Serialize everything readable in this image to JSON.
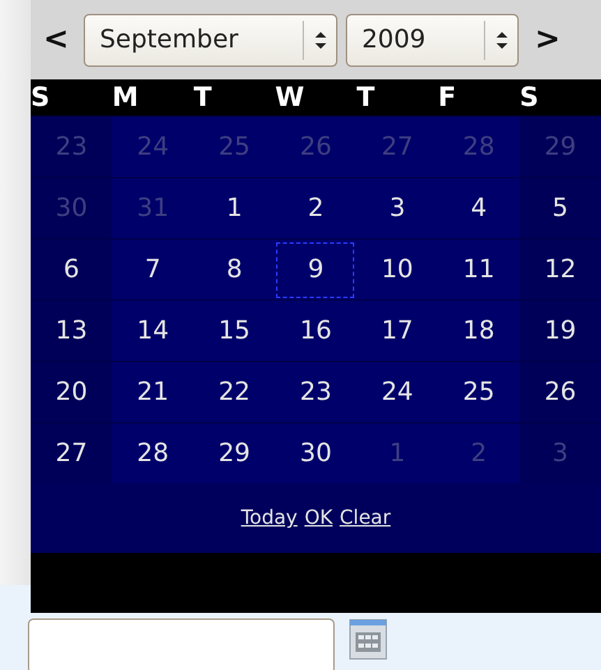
{
  "navigation": {
    "previous": "<",
    "next": ">"
  },
  "month_select": {
    "value": "September"
  },
  "year_select": {
    "value": "2009"
  },
  "weekdays": [
    "S",
    "M",
    "T",
    "W",
    "T",
    "F",
    "S"
  ],
  "weeks": [
    [
      {
        "day": "23",
        "other_month": true,
        "focused": false
      },
      {
        "day": "24",
        "other_month": true,
        "focused": false
      },
      {
        "day": "25",
        "other_month": true,
        "focused": false
      },
      {
        "day": "26",
        "other_month": true,
        "focused": false
      },
      {
        "day": "27",
        "other_month": true,
        "focused": false
      },
      {
        "day": "28",
        "other_month": true,
        "focused": false
      },
      {
        "day": "29",
        "other_month": true,
        "focused": false
      }
    ],
    [
      {
        "day": "30",
        "other_month": true,
        "focused": false
      },
      {
        "day": "31",
        "other_month": true,
        "focused": false
      },
      {
        "day": "1",
        "other_month": false,
        "focused": false
      },
      {
        "day": "2",
        "other_month": false,
        "focused": false
      },
      {
        "day": "3",
        "other_month": false,
        "focused": false
      },
      {
        "day": "4",
        "other_month": false,
        "focused": false
      },
      {
        "day": "5",
        "other_month": false,
        "focused": false
      }
    ],
    [
      {
        "day": "6",
        "other_month": false,
        "focused": false
      },
      {
        "day": "7",
        "other_month": false,
        "focused": false
      },
      {
        "day": "8",
        "other_month": false,
        "focused": false
      },
      {
        "day": "9",
        "other_month": false,
        "focused": true
      },
      {
        "day": "10",
        "other_month": false,
        "focused": false
      },
      {
        "day": "11",
        "other_month": false,
        "focused": false
      },
      {
        "day": "12",
        "other_month": false,
        "focused": false
      }
    ],
    [
      {
        "day": "13",
        "other_month": false,
        "focused": false
      },
      {
        "day": "14",
        "other_month": false,
        "focused": false
      },
      {
        "day": "15",
        "other_month": false,
        "focused": false
      },
      {
        "day": "16",
        "other_month": false,
        "focused": false
      },
      {
        "day": "17",
        "other_month": false,
        "focused": false
      },
      {
        "day": "18",
        "other_month": false,
        "focused": false
      },
      {
        "day": "19",
        "other_month": false,
        "focused": false
      }
    ],
    [
      {
        "day": "20",
        "other_month": false,
        "focused": false
      },
      {
        "day": "21",
        "other_month": false,
        "focused": false
      },
      {
        "day": "22",
        "other_month": false,
        "focused": false
      },
      {
        "day": "23",
        "other_month": false,
        "focused": false
      },
      {
        "day": "24",
        "other_month": false,
        "focused": false
      },
      {
        "day": "25",
        "other_month": false,
        "focused": false
      },
      {
        "day": "26",
        "other_month": false,
        "focused": false
      }
    ],
    [
      {
        "day": "27",
        "other_month": false,
        "focused": false
      },
      {
        "day": "28",
        "other_month": false,
        "focused": false
      },
      {
        "day": "29",
        "other_month": false,
        "focused": false
      },
      {
        "day": "30",
        "other_month": false,
        "focused": false
      },
      {
        "day": "1",
        "other_month": true,
        "focused": false
      },
      {
        "day": "2",
        "other_month": true,
        "focused": false
      },
      {
        "day": "3",
        "other_month": true,
        "focused": false
      }
    ]
  ],
  "links": [
    "Today",
    "OK",
    "Clear"
  ]
}
